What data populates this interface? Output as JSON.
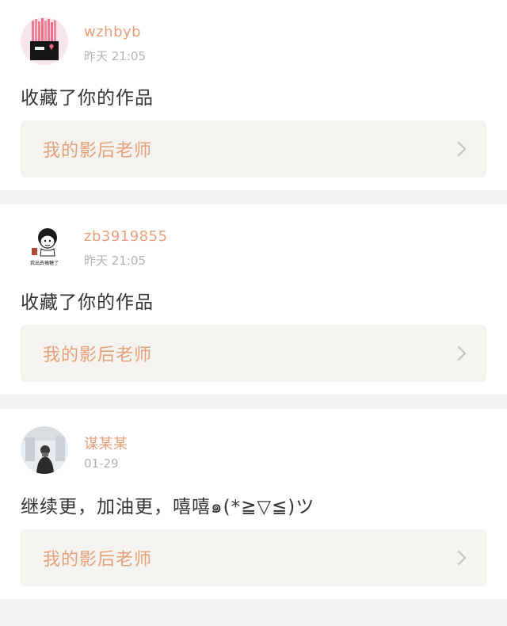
{
  "colors": {
    "accent": "#e7a07a",
    "link_bg": "#f4f3ef",
    "page_bg": "#f2f2f2"
  },
  "feed": [
    {
      "username": "wzhbyb",
      "time": "昨天  21:05",
      "content": "收藏了你的作品",
      "link_label": "我的影后老师",
      "avatar_icon": "pink-fries-avatar"
    },
    {
      "username": "zb3919855",
      "time": "昨天  21:05",
      "content": "收藏了你的作品",
      "link_label": "我的影后老师",
      "avatar_icon": "meme-cartoon-avatar",
      "avatar_caption": "我出去搞糖了"
    },
    {
      "username": "谋某某",
      "time": "01-29",
      "content": "继续更，加油更，嘻嘻๑(*≧▽≦)ツ",
      "link_label": "我的影后老师",
      "avatar_icon": "person-photo-avatar"
    }
  ]
}
